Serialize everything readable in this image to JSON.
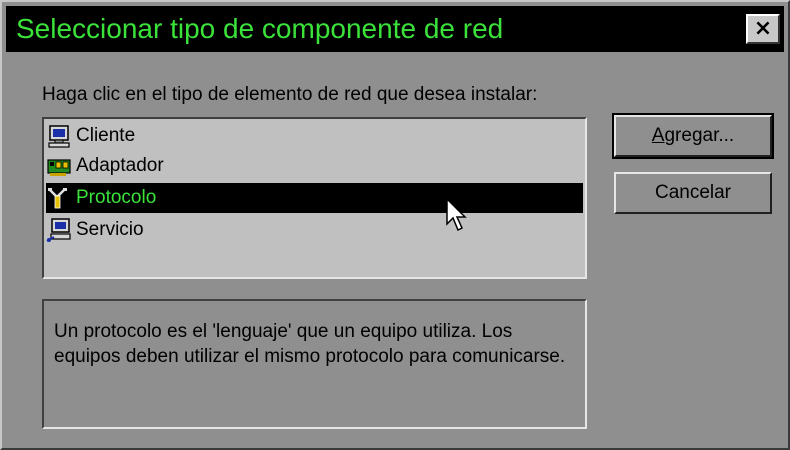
{
  "window": {
    "title": "Seleccionar tipo de componente de red",
    "close_glyph": "×"
  },
  "prompt": "Haga clic en el tipo de elemento de red que desea instalar:",
  "list": {
    "items": [
      {
        "label": "Cliente",
        "icon": "computer-icon",
        "selected": false
      },
      {
        "label": "Adaptador",
        "icon": "network-card-icon",
        "selected": false
      },
      {
        "label": "Protocolo",
        "icon": "protocol-plug-icon",
        "selected": true
      },
      {
        "label": "Servicio",
        "icon": "service-computer-icon",
        "selected": false
      }
    ]
  },
  "buttons": {
    "add_prefix": "A",
    "add_rest": "gregar...",
    "cancel": "Cancelar"
  },
  "description": "Un protocolo es el 'lenguaje' que un equipo utiliza. Los equipos deben utilizar el mismo protocolo para comunicarse.",
  "colors": {
    "title_bg": "#000000",
    "title_text": "#3ae23a",
    "dialog_bg": "#8f8f8f",
    "list_bg": "#c0c0c0",
    "selection_bg": "#000000",
    "selection_text": "#3ae23a"
  }
}
